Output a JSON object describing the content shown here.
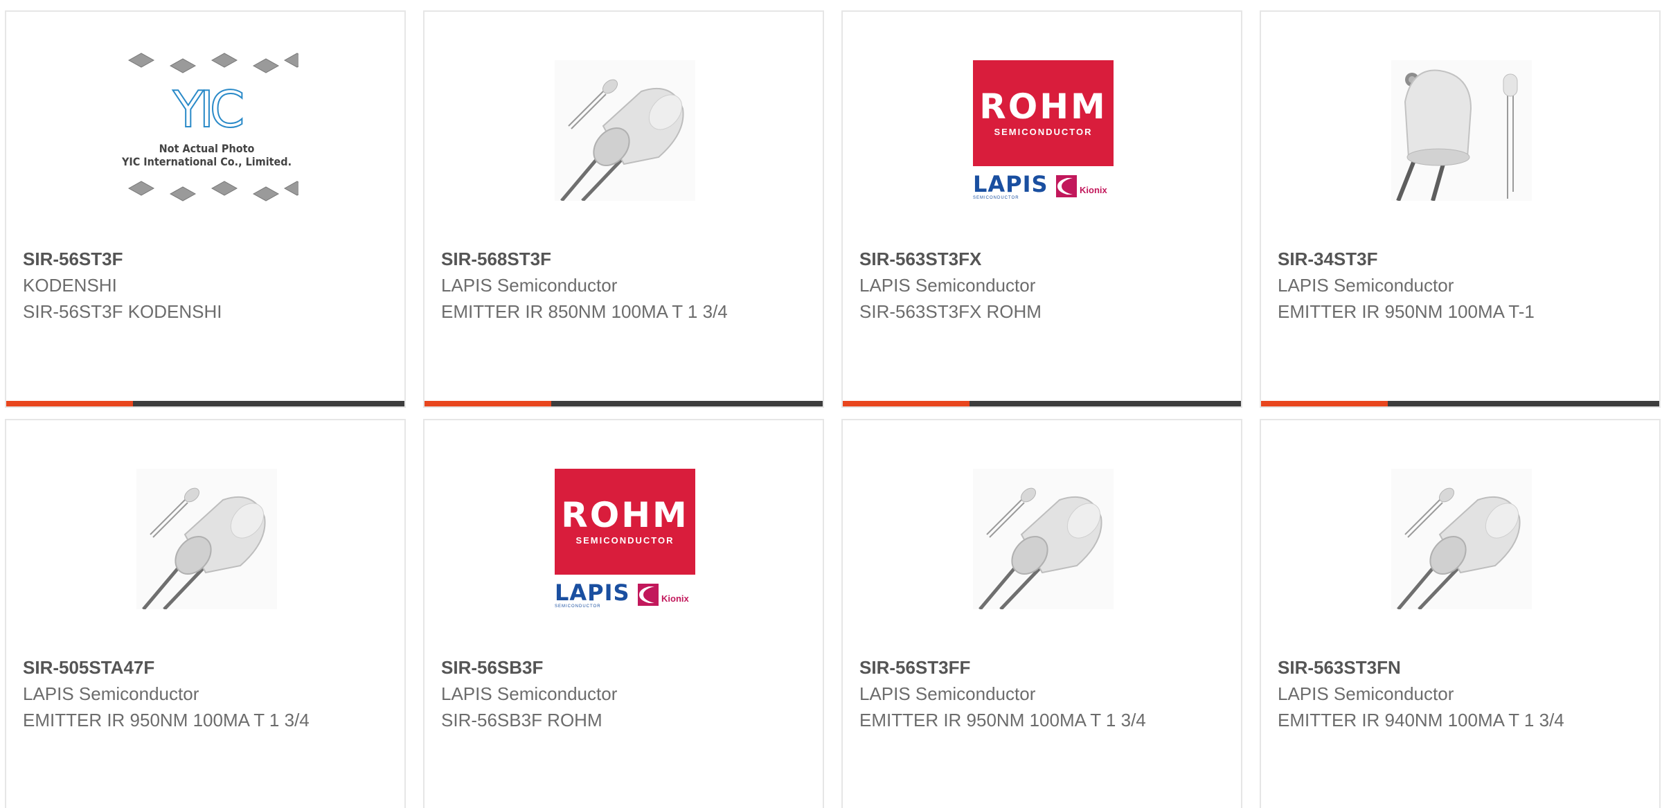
{
  "colors": {
    "accent": "#e8461e",
    "bar": "#3d3d3d",
    "border": "#e6e6e6",
    "title": "#555555",
    "text": "#6c6c6c",
    "rohm_red": "#d91d3c",
    "lapis_blue": "#1a4fa0"
  },
  "products": [
    {
      "part": "SIR-56ST3F",
      "manufacturer": "KODENSHI",
      "description": "SIR-56ST3F KODENSHI",
      "image": "not-actual-photo-placeholder",
      "placeholder_logo": "YIC",
      "placeholder_line1": "Not Actual Photo",
      "placeholder_line2": "YIC International Co., Limited."
    },
    {
      "part": "SIR-568ST3F",
      "manufacturer": "LAPIS Semiconductor",
      "description": "EMITTER IR 850NM 100MA T 1 3/4",
      "image": "ir-led-photo"
    },
    {
      "part": "SIR-563ST3FX",
      "manufacturer": "LAPIS Semiconductor",
      "description": "SIR-563ST3FX ROHM",
      "image": "rohm-logo",
      "logo_text": "ROHM",
      "logo_sub": "SEMICONDUCTOR",
      "logo2_text": "LAPIS",
      "logo2_sub": "SEMICONDUCTOR",
      "logo3_text": "Kionix"
    },
    {
      "part": "SIR-34ST3F",
      "manufacturer": "LAPIS Semiconductor",
      "description": "EMITTER IR 950NM 100MA T-1",
      "image": "ir-led-large-photo"
    },
    {
      "part": "SIR-505STA47F",
      "manufacturer": "LAPIS Semiconductor",
      "description": "EMITTER IR 950NM 100MA T 1 3/4",
      "image": "ir-led-photo"
    },
    {
      "part": "SIR-56SB3F",
      "manufacturer": "LAPIS Semiconductor",
      "description": "SIR-56SB3F ROHM",
      "image": "rohm-logo",
      "logo_text": "ROHM",
      "logo_sub": "SEMICONDUCTOR",
      "logo2_text": "LAPIS",
      "logo2_sub": "SEMICONDUCTOR",
      "logo3_text": "Kionix"
    },
    {
      "part": "SIR-56ST3FF",
      "manufacturer": "LAPIS Semiconductor",
      "description": "EMITTER IR 950NM 100MA T 1 3/4",
      "image": "ir-led-photo"
    },
    {
      "part": "SIR-563ST3FN",
      "manufacturer": "LAPIS Semiconductor",
      "description": "EMITTER IR 940NM 100MA T 1 3/4",
      "image": "ir-led-photo"
    }
  ]
}
